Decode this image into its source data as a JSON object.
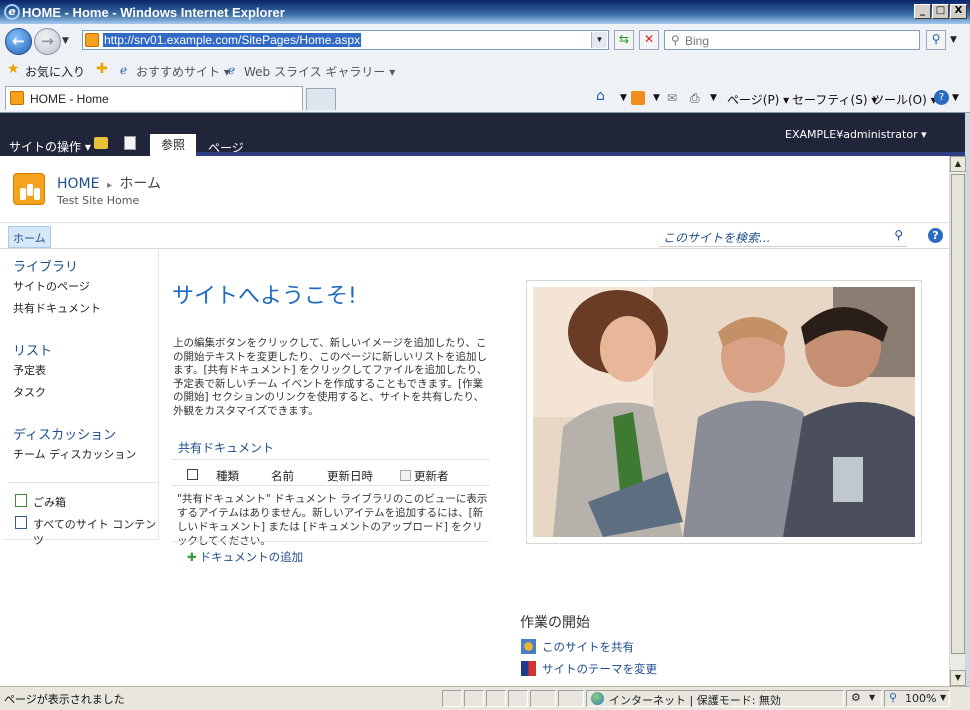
{
  "window": {
    "title": "HOME - Home - Windows Internet Explorer",
    "url": "http://srv01.example.com/SitePages/Home.aspx",
    "search_placeholder": "Bing",
    "minimize": "_",
    "maximize": "□",
    "close": "X"
  },
  "favorites_bar": {
    "favorites": "お気に入り",
    "suggested_sites": "おすすめサイト ▾",
    "web_slice": "Web スライス ギャラリー ▾"
  },
  "tab": {
    "title": "HOME - Home"
  },
  "command_bar": {
    "page": "ページ(P) ▾",
    "safety": "セーフティ(S) ▾",
    "tools": "ツール(O) ▾"
  },
  "ribbon": {
    "site_actions": "サイトの操作 ▾",
    "tab_browse": "参照",
    "tab_page": "ページ",
    "user": "EXAMPLE¥administrator ▾"
  },
  "header": {
    "site_name": "HOME",
    "breadcrumb_separator": "▸",
    "page_name": "ホーム",
    "subtitle": "Test Site Home"
  },
  "top_nav": {
    "home": "ホーム",
    "search_placeholder": "このサイトを検索...",
    "help": "?"
  },
  "left_nav": {
    "libraries_heading": "ライブラリ",
    "site_pages": "サイトのページ",
    "shared_documents": "共有ドキュメント",
    "lists_heading": "リスト",
    "calendar": "予定表",
    "tasks": "タスク",
    "discussions_heading": "ディスカッション",
    "team_discussion": "チーム ディスカッション",
    "recycle_bin": "ごみ箱",
    "all_site_content": "すべてのサイト コンテンツ"
  },
  "main": {
    "welcome": "サイトへようこそ!",
    "intro": "上の編集ボタンをクリックして、新しいイメージを追加したり、この開始テキストを変更したり、このページに新しいリストを追加します。[共有ドキュメント] をクリックしてファイルを追加したり、予定表で新しいチーム イベントを作成することもできます。[作業の開始] セクションのリンクを使用すると、サイトを共有したり、外観をカスタマイズできます。",
    "doc_library_title": "共有ドキュメント",
    "columns": {
      "type": "種類",
      "name": "名前",
      "modified": "更新日時",
      "modified_by": "更新者"
    },
    "empty_message": "\"共有ドキュメント\" ドキュメント ライブラリのこのビューに表示するアイテムはありません。新しいアイテムを追加するには、[新しいドキュメント] または [ドキュメントのアップロード] をクリックしてください。",
    "add_document": "ドキュメントの追加"
  },
  "getting_started": {
    "title": "作業の開始",
    "share_site": "このサイトを共有",
    "change_theme": "サイトのテーマを変更"
  },
  "status_bar": {
    "message": "ページが表示されました",
    "zone": "インターネット | 保護モード: 無効",
    "zoom": "100%"
  },
  "colors": {
    "ribbon_bg": "#21253a",
    "link_blue": "#1f4e8d",
    "accent_orange": "#f5a31c"
  }
}
